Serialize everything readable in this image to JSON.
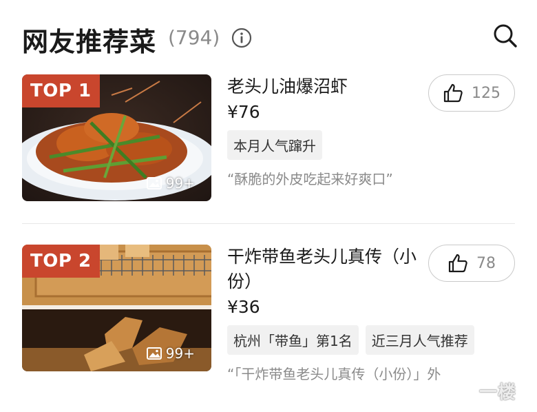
{
  "header": {
    "title": "网友推荐菜",
    "count": "(794)"
  },
  "dishes": [
    {
      "rank": "TOP 1",
      "photo_count": "99+",
      "name": "老头儿油爆沼虾",
      "price": "¥76",
      "tags": [
        "本月人气蹿升"
      ],
      "quote": "“酥脆的外皮吃起来好爽口”",
      "likes": "125"
    },
    {
      "rank": "TOP 2",
      "photo_count": "99+",
      "name": "干炸带鱼老头儿真传（小份）",
      "price": "¥36",
      "tags": [
        "杭州「带鱼」第1名",
        "近三月人气推荐"
      ],
      "quote": "“「干炸带鱼老头儿真传（小份）」外",
      "likes": "78"
    }
  ],
  "watermark": "一楼",
  "colors": {
    "badge": "#c9462d",
    "muted": "#8a8a8a",
    "tag_bg": "#f1f1f1"
  }
}
